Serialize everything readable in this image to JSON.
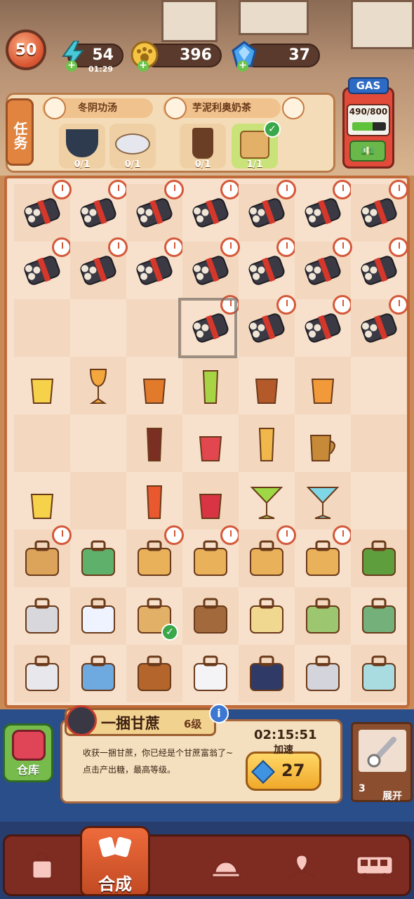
{
  "player": {
    "level": "50"
  },
  "resources": {
    "energy": {
      "value": "54",
      "timer": "01:29",
      "icon": "lightning-icon"
    },
    "coins": {
      "value": "396",
      "icon": "paw-coin-icon"
    },
    "gems": {
      "value": "37",
      "icon": "gem-icon"
    }
  },
  "tasks": {
    "tab_label": "任务",
    "orders": [
      {
        "title": "冬阴功汤",
        "slots": [
          {
            "item": "shrimp-bowl",
            "progress": "0/1",
            "done": false
          },
          {
            "item": "roast-chicken",
            "progress": "0/1",
            "done": false
          }
        ]
      },
      {
        "title": "芋泥利奥奶茶",
        "slots": [
          {
            "item": "milk-tea",
            "progress": "0/1",
            "done": false
          },
          {
            "item": "takeout-bag",
            "progress": "1/1",
            "done": true
          }
        ]
      }
    ]
  },
  "gas_station": {
    "sign": "GAS",
    "amount": "490/800",
    "fill": 0.61
  },
  "info": {
    "name": "一捆甘蔗",
    "level": "6级",
    "description": "收获一捆甘蔗，你已经是个甘蔗富翁了~",
    "hint": "点击产出糖，最高等级。",
    "timer": "02:15:51",
    "speed_label": "加速",
    "speed_cost": "27"
  },
  "warehouse": {
    "label": "仓库"
  },
  "expand": {
    "count": "3",
    "label": "展开"
  },
  "nav": {
    "items": [
      {
        "name": "shop",
        "label": ""
      },
      {
        "name": "merge",
        "label": "合成"
      },
      {
        "name": "serve",
        "label": ""
      },
      {
        "name": "map",
        "label": ""
      },
      {
        "name": "bus",
        "label": ""
      }
    ]
  },
  "board": {
    "rows": [
      [
        "sugarcane-timer",
        "sugarcane-timer",
        "sugarcane-timer",
        "sugarcane-timer",
        "sugarcane-timer",
        "sugarcane-timer",
        "sugarcane-timer"
      ],
      [
        "sugarcane-timer",
        "sugarcane-timer",
        "sugarcane-timer",
        "sugarcane-timer",
        "sugarcane-timer",
        "sugarcane-timer",
        "sugarcane-timer"
      ],
      [
        "empty",
        "empty",
        "empty",
        "sugarcane-timer",
        "sugarcane-timer",
        "sugarcane-timer",
        "sugarcane-timer"
      ],
      [
        "lemon-shot",
        "wine-glass",
        "whiskey",
        "green-juice",
        "cola-glass",
        "orange-cocktail",
        "empty"
      ],
      [
        "empty",
        "empty",
        "iced-cola",
        "red-punch",
        "beer",
        "matcha-mug",
        "empty"
      ],
      [
        "lemon-shot-cloud",
        "empty",
        "sunrise-cocktail",
        "red-soda",
        "martini",
        "blue-margarita",
        "empty"
      ],
      [
        "hand-truck-timer",
        "scooter",
        "drone-box-timer",
        "drone-box-timer",
        "drone-box-timer",
        "drone-box-timer",
        "tree"
      ],
      [
        "printer",
        "notepad",
        "takeout-bag-check",
        "spice-rack",
        "dessert-cart",
        "rice-cooker",
        "hotpot"
      ],
      [
        "oven",
        "photo-album",
        "barrel",
        "chef-hat",
        "chef-hat-blue",
        "safe",
        "fridge"
      ]
    ]
  }
}
